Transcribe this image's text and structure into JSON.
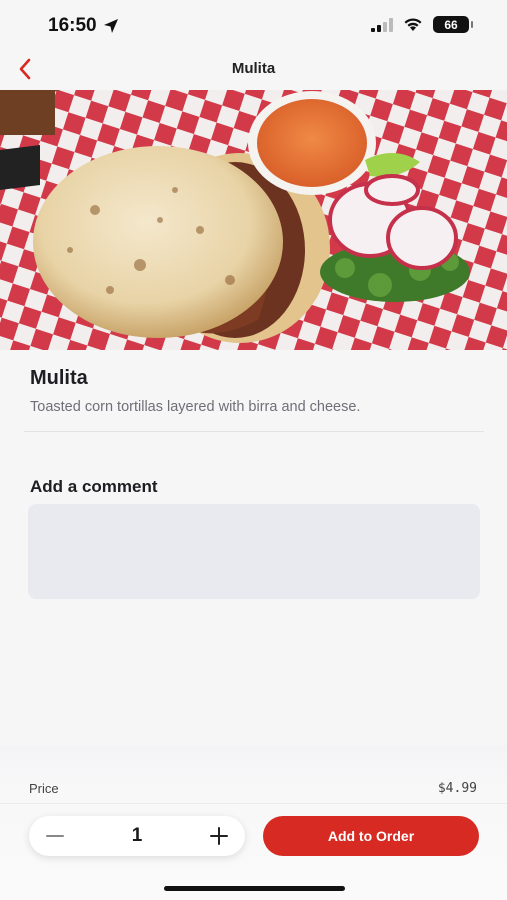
{
  "status": {
    "time": "16:50",
    "battery": "66",
    "icons": [
      "location-arrow-icon",
      "cellular-signal-icon",
      "wifi-icon",
      "battery-icon"
    ]
  },
  "nav": {
    "title": "Mulita",
    "back_icon": "chevron-left-icon"
  },
  "item": {
    "name": "Mulita",
    "description": "Toasted corn tortillas layered with birra and cheese.",
    "image": "food-photo"
  },
  "comment": {
    "label": "Add a comment",
    "value": "",
    "placeholder": ""
  },
  "order": {
    "price_label": "Price",
    "price_value": "$4.99",
    "quantity": "1",
    "add_label": "Add to Order"
  },
  "colors": {
    "accent": "#d72a22",
    "background": "#f6f6f7",
    "input_bg": "#e9eaf0",
    "muted_text": "#6f6f78"
  }
}
